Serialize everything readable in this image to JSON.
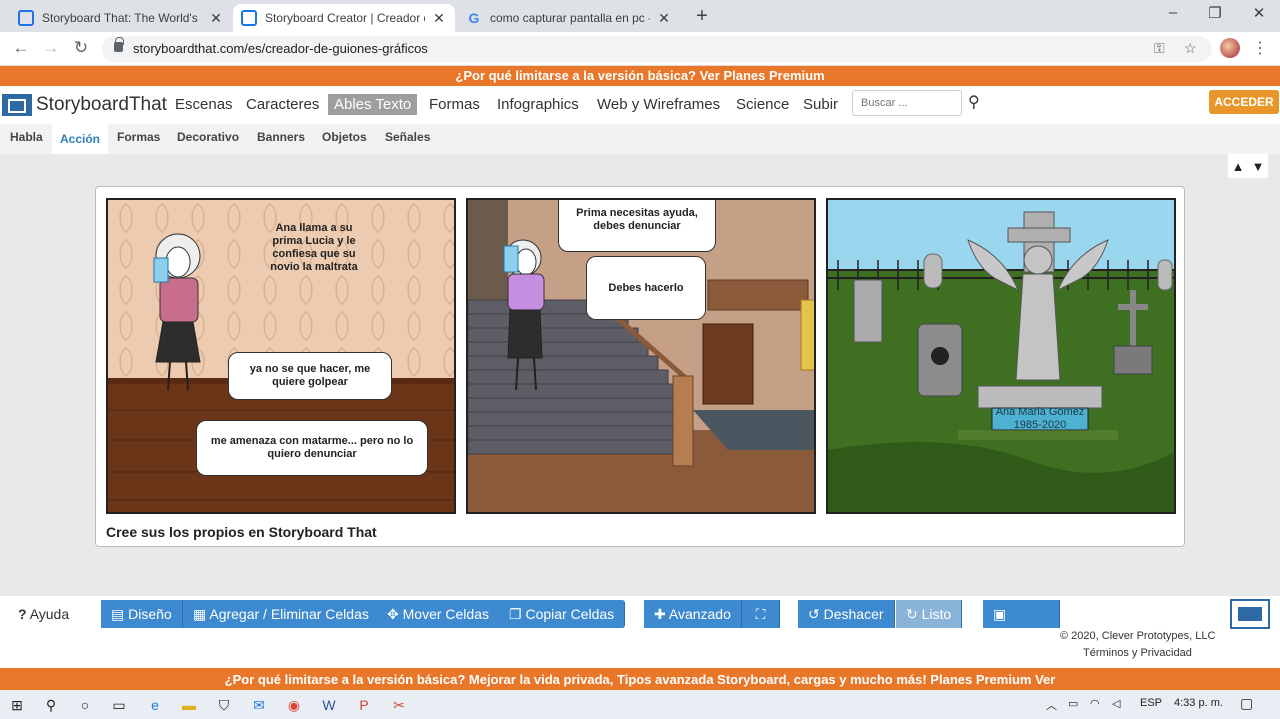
{
  "browser": {
    "tabs": [
      {
        "title": "Storyboard That: The World's Bes",
        "active": false
      },
      {
        "title": "Storyboard Creator | Creador de",
        "active": true
      },
      {
        "title": "como capturar pantalla en pc - B",
        "active": false
      }
    ],
    "new_tab": "+",
    "url": "storyboardthat.com/es/creador-de-guiones-gráficos",
    "window_controls": {
      "minimize": "–",
      "maximize": "❐",
      "close": "✕"
    }
  },
  "promo_top": "¿Por qué limitarse a la versión básica? Ver Planes Premium",
  "site": {
    "logo_text": "StoryboardThat",
    "nav": [
      "Escenas",
      "Caracteres",
      "Ables Texto",
      "Formas",
      "Infographics",
      "Web y Wireframes",
      "Science",
      "Subir"
    ],
    "nav_selected": "Ables Texto",
    "search_placeholder": "Buscar ...",
    "login_label": "ACCEDER",
    "subnav": [
      "Habla",
      "Acción",
      "Formas",
      "Decorativo",
      "Banners",
      "Objetos",
      "Señales"
    ],
    "subnav_active": "Acción"
  },
  "storyboard": {
    "cells": [
      {
        "caption": "Ana llama a su prima Lucia y le confiesa que su novio la maltrata",
        "bubbles": [
          "ya no se que hacer, me quiere golpear",
          "me amenaza con matarme... pero no lo quiero denunciar"
        ]
      },
      {
        "bubbles": [
          "Prima necesitas ayuda, debes denunciar",
          "Debes hacerlo"
        ]
      },
      {
        "plaque": "Ana Maria Gomez 1985-2020"
      }
    ],
    "footer": "Cree sus los propios en Storyboard That"
  },
  "toolbar": {
    "help": "Ayuda",
    "buttons": [
      "Diseño",
      "Agregar / Eliminar Celdas",
      "Mover Celdas",
      "Copiar Celdas",
      "Avanzado",
      "Deshacer",
      "Listo",
      "Salvar"
    ],
    "copyright": "© 2020, Clever Prototypes, LLC",
    "terms": "Términos y Privacidad"
  },
  "promo_bottom": "¿Por qué limitarse a la versión básica? Mejorar la vida privada, Tipos avanzada Storyboard, cargas y mucho más! Planes Premium Ver",
  "taskbar": {
    "language": "ESP",
    "time": "4:33 p. m."
  },
  "colors": {
    "promo": "#e8772a",
    "accent_button": "#3d8ad0",
    "login_button": "#e8962a",
    "logo_blue": "#2d6aa3"
  }
}
